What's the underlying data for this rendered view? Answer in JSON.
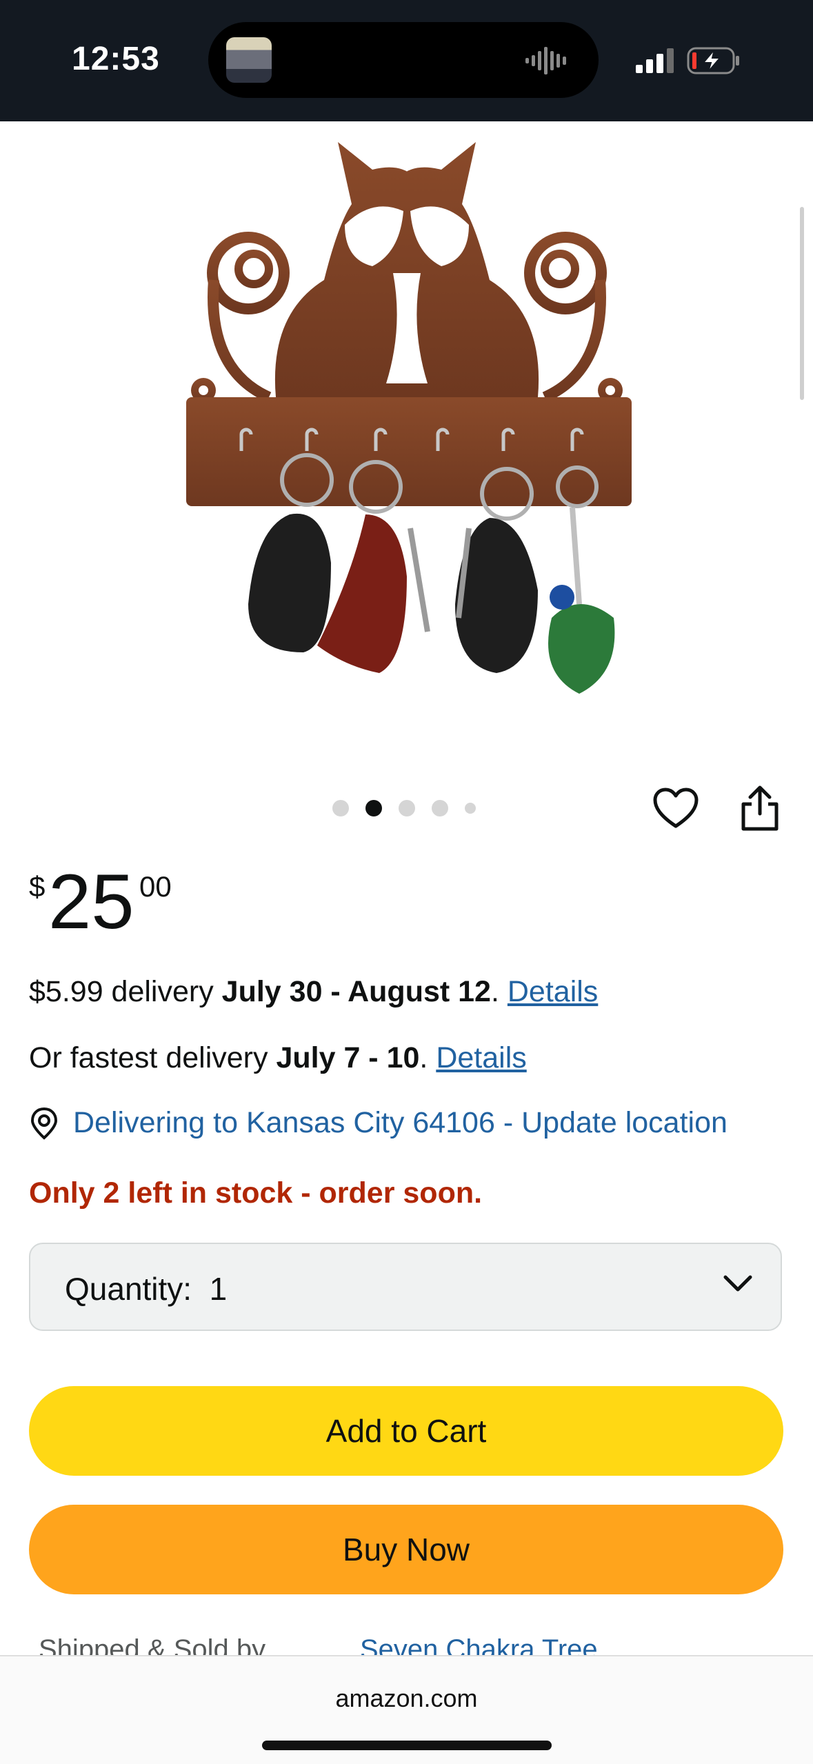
{
  "status_bar": {
    "time": "12:53"
  },
  "product": {
    "image_alt": "Wooden cat key holder with keys",
    "carousel": {
      "count": 5,
      "active_index": 1
    }
  },
  "price": {
    "currency": "$",
    "whole": "25",
    "fraction": "00"
  },
  "delivery": {
    "standard_prefix": "$5.99 delivery ",
    "standard_dates": "July 30 - August 12",
    "standard_suffix": ". ",
    "standard_link": "Details",
    "fastest_prefix": "Or fastest delivery ",
    "fastest_dates": "July 7 - 10",
    "fastest_suffix": ". ",
    "fastest_link": "Details",
    "location": "Delivering to Kansas City 64106 - Update location"
  },
  "stock": "Only 2 left in stock - order soon.",
  "quantity": {
    "label": "Quantity:",
    "value": "1"
  },
  "buttons": {
    "add_to_cart": "Add to Cart",
    "buy_now": "Buy Now"
  },
  "seller": {
    "label": "Shipped & Sold by",
    "name": "Seven Chakra Tree"
  },
  "browser": {
    "domain": "amazon.com"
  },
  "colors": {
    "header": "#131921",
    "add_to_cart": "#ffd814",
    "buy_now": "#ffa41c",
    "link": "#2162a1",
    "stock_warning": "#b12704"
  }
}
